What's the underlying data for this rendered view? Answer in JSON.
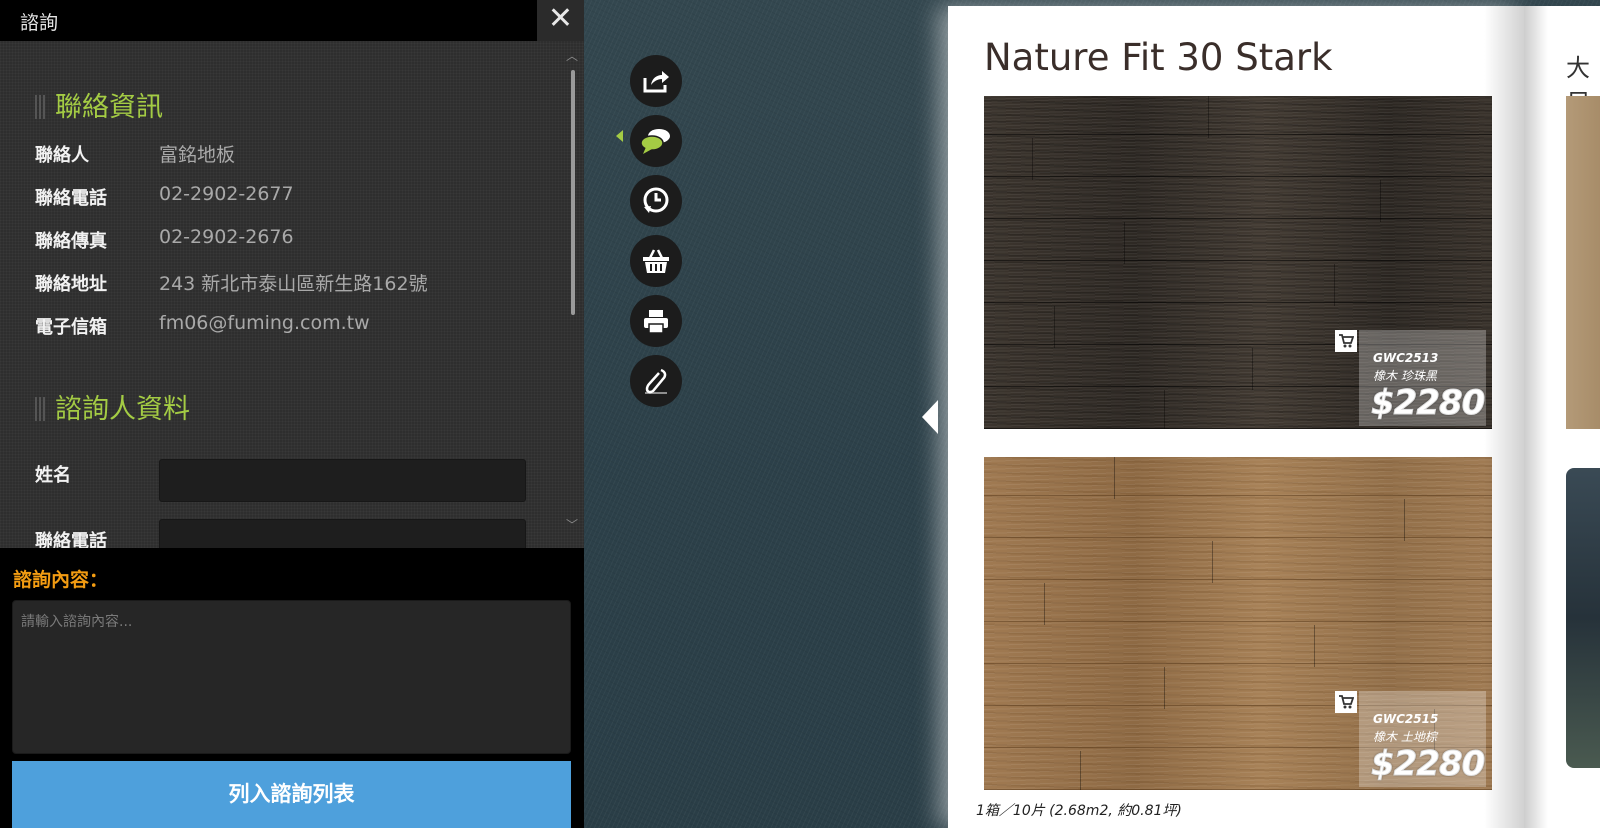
{
  "panel": {
    "title": "諮詢",
    "close_label": "✕",
    "contact_heading": "聯絡資訊",
    "contact_rows": [
      {
        "label": "聯絡人",
        "value": "富銘地板"
      },
      {
        "label": "聯絡電話",
        "value": "02-2902-2677"
      },
      {
        "label": "聯絡傳真",
        "value": "02-2902-2676"
      },
      {
        "label": "聯絡地址",
        "value": "243 新北市泰山區新生路162號"
      },
      {
        "label": "電子信箱",
        "value": "fm06@fuming.com.tw"
      }
    ],
    "inquirer_heading": "諮詢人資料",
    "inquirer_fields": [
      {
        "label": "姓名",
        "value": ""
      },
      {
        "label": "聯絡電話",
        "value": ""
      }
    ],
    "content_label": "諮詢內容：",
    "content_placeholder": "請輸入諮詢內容...",
    "submit_label": "列入諮詢列表"
  },
  "toolbar": {
    "items": [
      {
        "name": "share",
        "icon": "share-icon"
      },
      {
        "name": "inquiry",
        "icon": "chat-icon",
        "active": true
      },
      {
        "name": "history",
        "icon": "history-icon"
      },
      {
        "name": "cart",
        "icon": "basket-icon"
      },
      {
        "name": "print",
        "icon": "print-icon"
      },
      {
        "name": "note",
        "icon": "note-icon"
      }
    ],
    "active_color": "#a4cc44"
  },
  "book": {
    "left_page": {
      "title": "Nature Fit 30 Stark",
      "products": [
        {
          "code": "GWC2513",
          "name": "橡木  珍珠黑",
          "price": "$2280"
        },
        {
          "code": "GWC2515",
          "name": "橡木  土地棕",
          "price": "$2280"
        }
      ],
      "spec_note": "1箱／10片 (2.68m2, 約0.81坪)"
    },
    "right_page": {
      "title": "大尺"
    }
  },
  "colors": {
    "heading_green": "#a4cc44",
    "label_orange": "#f39c12",
    "submit_blue": "#4ea0dc"
  }
}
